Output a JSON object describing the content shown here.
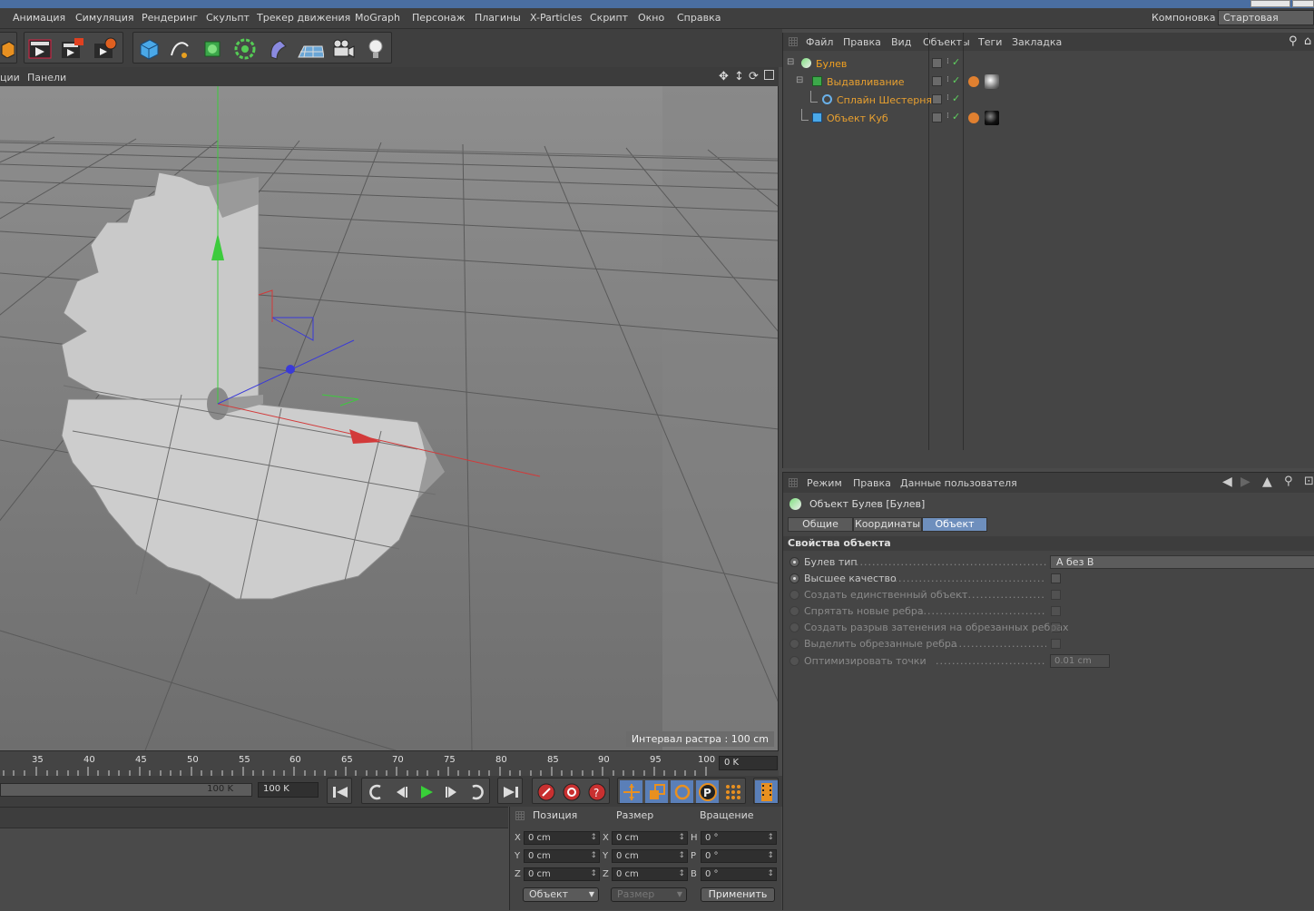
{
  "menu": {
    "items": [
      "Анимация",
      "Симуляция",
      "Рендеринг",
      "Скульпт",
      "Трекер движения",
      "MoGraph",
      "Персонаж",
      "Плагины",
      "X-Particles",
      "Скрипт",
      "Окно",
      "Справка"
    ],
    "layout_label": "Компоновка",
    "layout_value": "Стартовая"
  },
  "viewport": {
    "menu": [
      "ции",
      "Панели"
    ],
    "hud": "Интервал растра : 100 cm"
  },
  "timeline": {
    "ticks": [
      "35",
      "40",
      "45",
      "50",
      "55",
      "60",
      "65",
      "70",
      "75",
      "80",
      "85",
      "90",
      "95",
      "100"
    ],
    "current_frame": "0 K"
  },
  "playback": {
    "end_field": "100 K",
    "max_field": "100 K"
  },
  "coords": {
    "headers": [
      "Позиция",
      "Размер",
      "Вращение"
    ],
    "rows": [
      {
        "pos_axis": "X",
        "pos": "0 cm",
        "size_axis": "X",
        "size": "0 cm",
        "rot_axis": "H",
        "rot": "0 °"
      },
      {
        "pos_axis": "Y",
        "pos": "0 cm",
        "size_axis": "Y",
        "size": "0 cm",
        "rot_axis": "P",
        "rot": "0 °"
      },
      {
        "pos_axis": "Z",
        "pos": "0 cm",
        "size_axis": "Z",
        "size": "0 cm",
        "rot_axis": "B",
        "rot": "0 °"
      }
    ],
    "mode_select": "Объект",
    "size_select": "Размер",
    "apply": "Применить"
  },
  "object_manager": {
    "menu": [
      "Файл",
      "Правка",
      "Вид",
      "Объекты",
      "Теги",
      "Закладка"
    ],
    "objects": [
      {
        "name": "Булев",
        "level": 0,
        "color": "#f0a020"
      },
      {
        "name": "Выдавливание",
        "level": 1,
        "color": "#e8902a"
      },
      {
        "name": "Сплайн Шестерня",
        "level": 2,
        "color": "#e8902a"
      },
      {
        "name": "Объект Куб",
        "level": 1,
        "color": "#e8902a"
      }
    ]
  },
  "attributes": {
    "menu": [
      "Режим",
      "Правка",
      "Данные пользователя"
    ],
    "title": "Объект Булев [Булев]",
    "tabs": [
      "Общие",
      "Координаты",
      "Объект"
    ],
    "section": "Свойства объекта",
    "props": [
      {
        "label": "Булев тип",
        "value": "A без B",
        "enabled": true
      },
      {
        "label": "Высшее качество",
        "enabled": true
      },
      {
        "label": "Создать единственный объект",
        "enabled": false
      },
      {
        "label": "Спрятать новые ребра",
        "enabled": false
      },
      {
        "label": "Создать разрыв затенения на обрезанных ребрах",
        "enabled": false
      },
      {
        "label": "Выделить обрезанные ребра",
        "enabled": false
      },
      {
        "label": "Оптимизировать точки",
        "value": "0.01 cm",
        "enabled": false
      }
    ]
  }
}
